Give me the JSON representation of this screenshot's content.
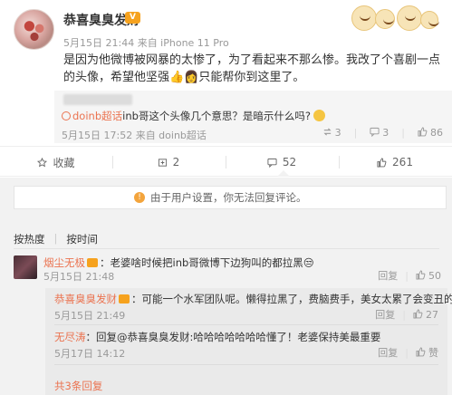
{
  "post": {
    "author": "恭喜臭臭发财",
    "vip_badge": "V",
    "meta": "5月15日 21:44 来自 iPhone 11 Pro",
    "text": "是因为他微博被网暴的太惨了，为了看起来不那么惨。我改了个喜剧一点的头像，希望他坚强👍👩只能帮你到这里了。"
  },
  "repost": {
    "tag": "doinb超话",
    "text": "inb哥这个头像几个意思？是暗示什么吗?",
    "meta": "5月15日 17:52 来自 doinb超话",
    "repost_count": "3",
    "comment_count": "3",
    "like_count": "86"
  },
  "action_bar": {
    "favorite": "收藏",
    "repost": "2",
    "comment": "52",
    "like": "261"
  },
  "notice": "由于用户设置，你无法回复评论。",
  "sort": {
    "hot": "按热度",
    "time": "按时间"
  },
  "comments": [
    {
      "user": "烟尘无极",
      "text": "：老婆啥时候把inb哥微博下边狗叫的都拉黑😒",
      "time": "5月15日 21:48",
      "reply": "回复",
      "likes": "50"
    }
  ],
  "replies": [
    {
      "user": "恭喜臭臭发财",
      "text": "：可能一个水军团队呢。懒得拉黑了，费脑费手，美女太累了会变丑的",
      "time": "5月15日 21:49",
      "reply": "回复",
      "likes": "27"
    },
    {
      "user": "无尽涛",
      "text": "：回复@恭喜臭臭发财:哈哈哈哈哈哈哈懂了！老婆保持美最重要",
      "time": "5月17日 14:12",
      "reply": "回复",
      "likes": "赞"
    }
  ],
  "more_replies": "共3条回复"
}
